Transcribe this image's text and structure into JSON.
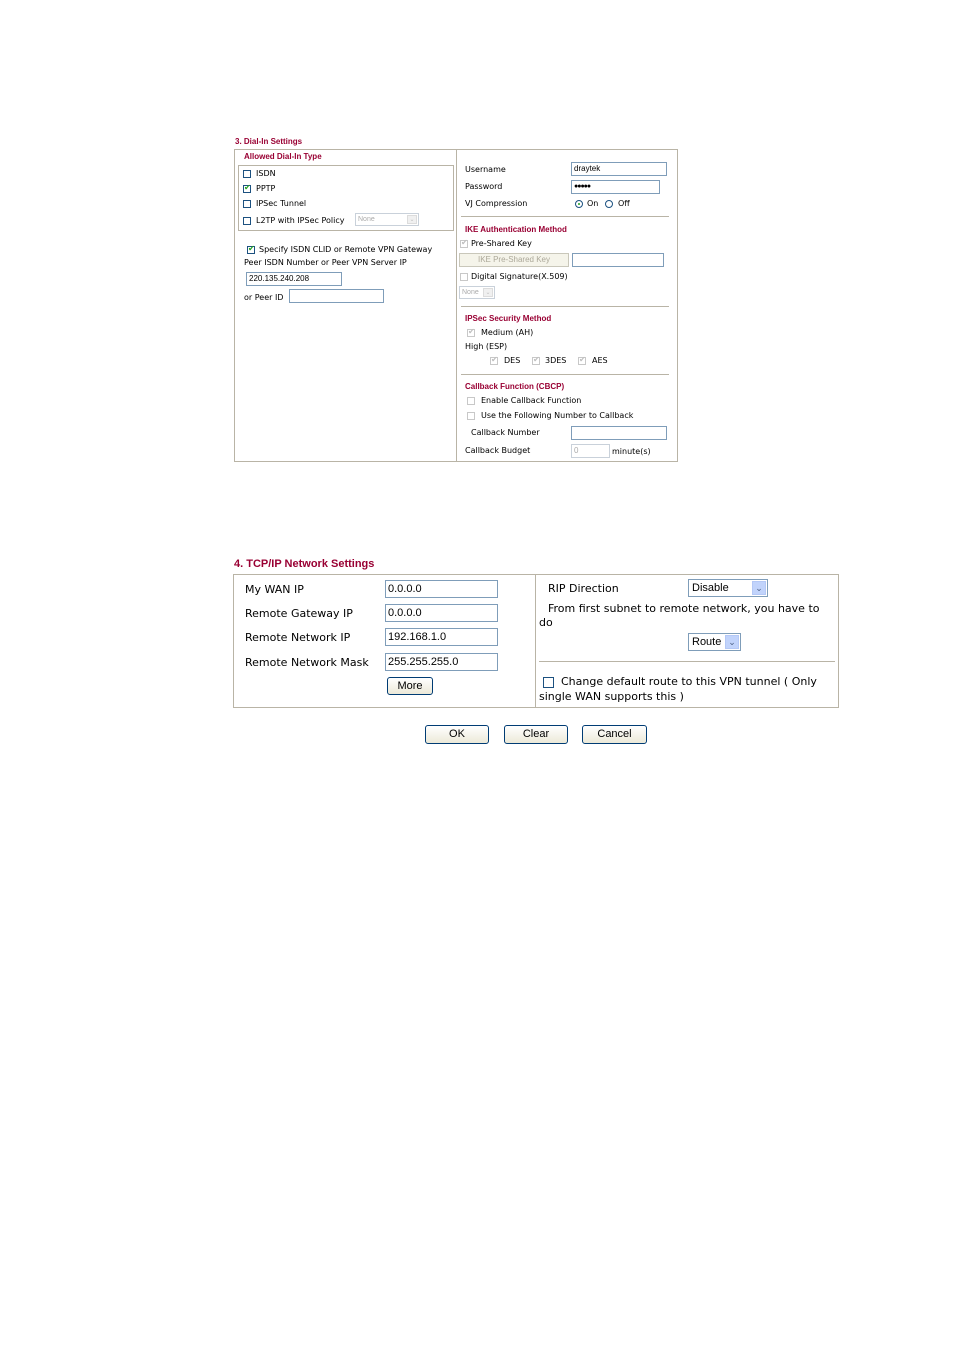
{
  "dial_in": {
    "section_title": "3. Dial-In Settings",
    "allowed_title": "Allowed Dial-In Type",
    "types": [
      {
        "label": "ISDN",
        "checked": false
      },
      {
        "label": "PPTP",
        "checked": true
      },
      {
        "label": "IPSec Tunnel",
        "checked": false
      },
      {
        "label": "L2TP with IPSec Policy",
        "checked": false
      }
    ],
    "l2tp_policy_select": "None",
    "specify_label": "Specify ISDN CLID or Remote VPN Gateway",
    "specify_checked": true,
    "peer_label": "Peer ISDN Number or Peer VPN Server IP",
    "peer_value": "220.135.240.208",
    "peer_id_label": "or Peer ID",
    "peer_id_value": "",
    "username_label": "Username",
    "username_value": "draytek",
    "password_label": "Password",
    "password_value": "●●●●●",
    "vj_label": "VJ Compression",
    "vj_on": "On",
    "vj_off": "Off",
    "vj_selected": "On",
    "ike_title": "IKE Authentication Method",
    "pre_shared_label": "Pre-Shared Key",
    "ike_psk_button": "IKE Pre-Shared Key",
    "ike_psk_value": "",
    "digital_sig_label": "Digital Signature(X.509)",
    "digital_sig_select": "None",
    "ipsec_title": "IPSec Security Method",
    "medium_label": "Medium (AH)",
    "high_label": "High (ESP)",
    "des_label": "DES",
    "3des_label": "3DES",
    "aes_label": "AES",
    "callback_title": "Callback Function (CBCP)",
    "enable_callback_label": "Enable Callback Function",
    "use_number_label": "Use the Following Number to Callback",
    "callback_number_label": "Callback Number",
    "callback_number_value": "",
    "callback_budget_label": "Callback Budget",
    "callback_budget_value": "0",
    "callback_budget_unit": "minute(s)"
  },
  "tcpip": {
    "section_title": "4. TCP/IP Network Settings",
    "fields": [
      {
        "label": "My WAN IP",
        "value": "0.0.0.0"
      },
      {
        "label": "Remote Gateway IP",
        "value": "0.0.0.0"
      },
      {
        "label": "Remote Network IP",
        "value": "192.168.1.0"
      },
      {
        "label": "Remote Network Mask",
        "value": "255.255.255.0"
      }
    ],
    "more_button": "More",
    "rip_label": "RIP Direction",
    "rip_value": "Disable",
    "subnet_text_1": "From first subnet to remote network, you have to",
    "subnet_text_2": "do",
    "route_value": "Route",
    "default_route_text_1": "Change default route to this VPN tunnel ( Only",
    "default_route_text_2": "single WAN supports this )",
    "default_route_checked": false
  },
  "actions": {
    "ok": "OK",
    "clear": "Clear",
    "cancel": "Cancel"
  }
}
